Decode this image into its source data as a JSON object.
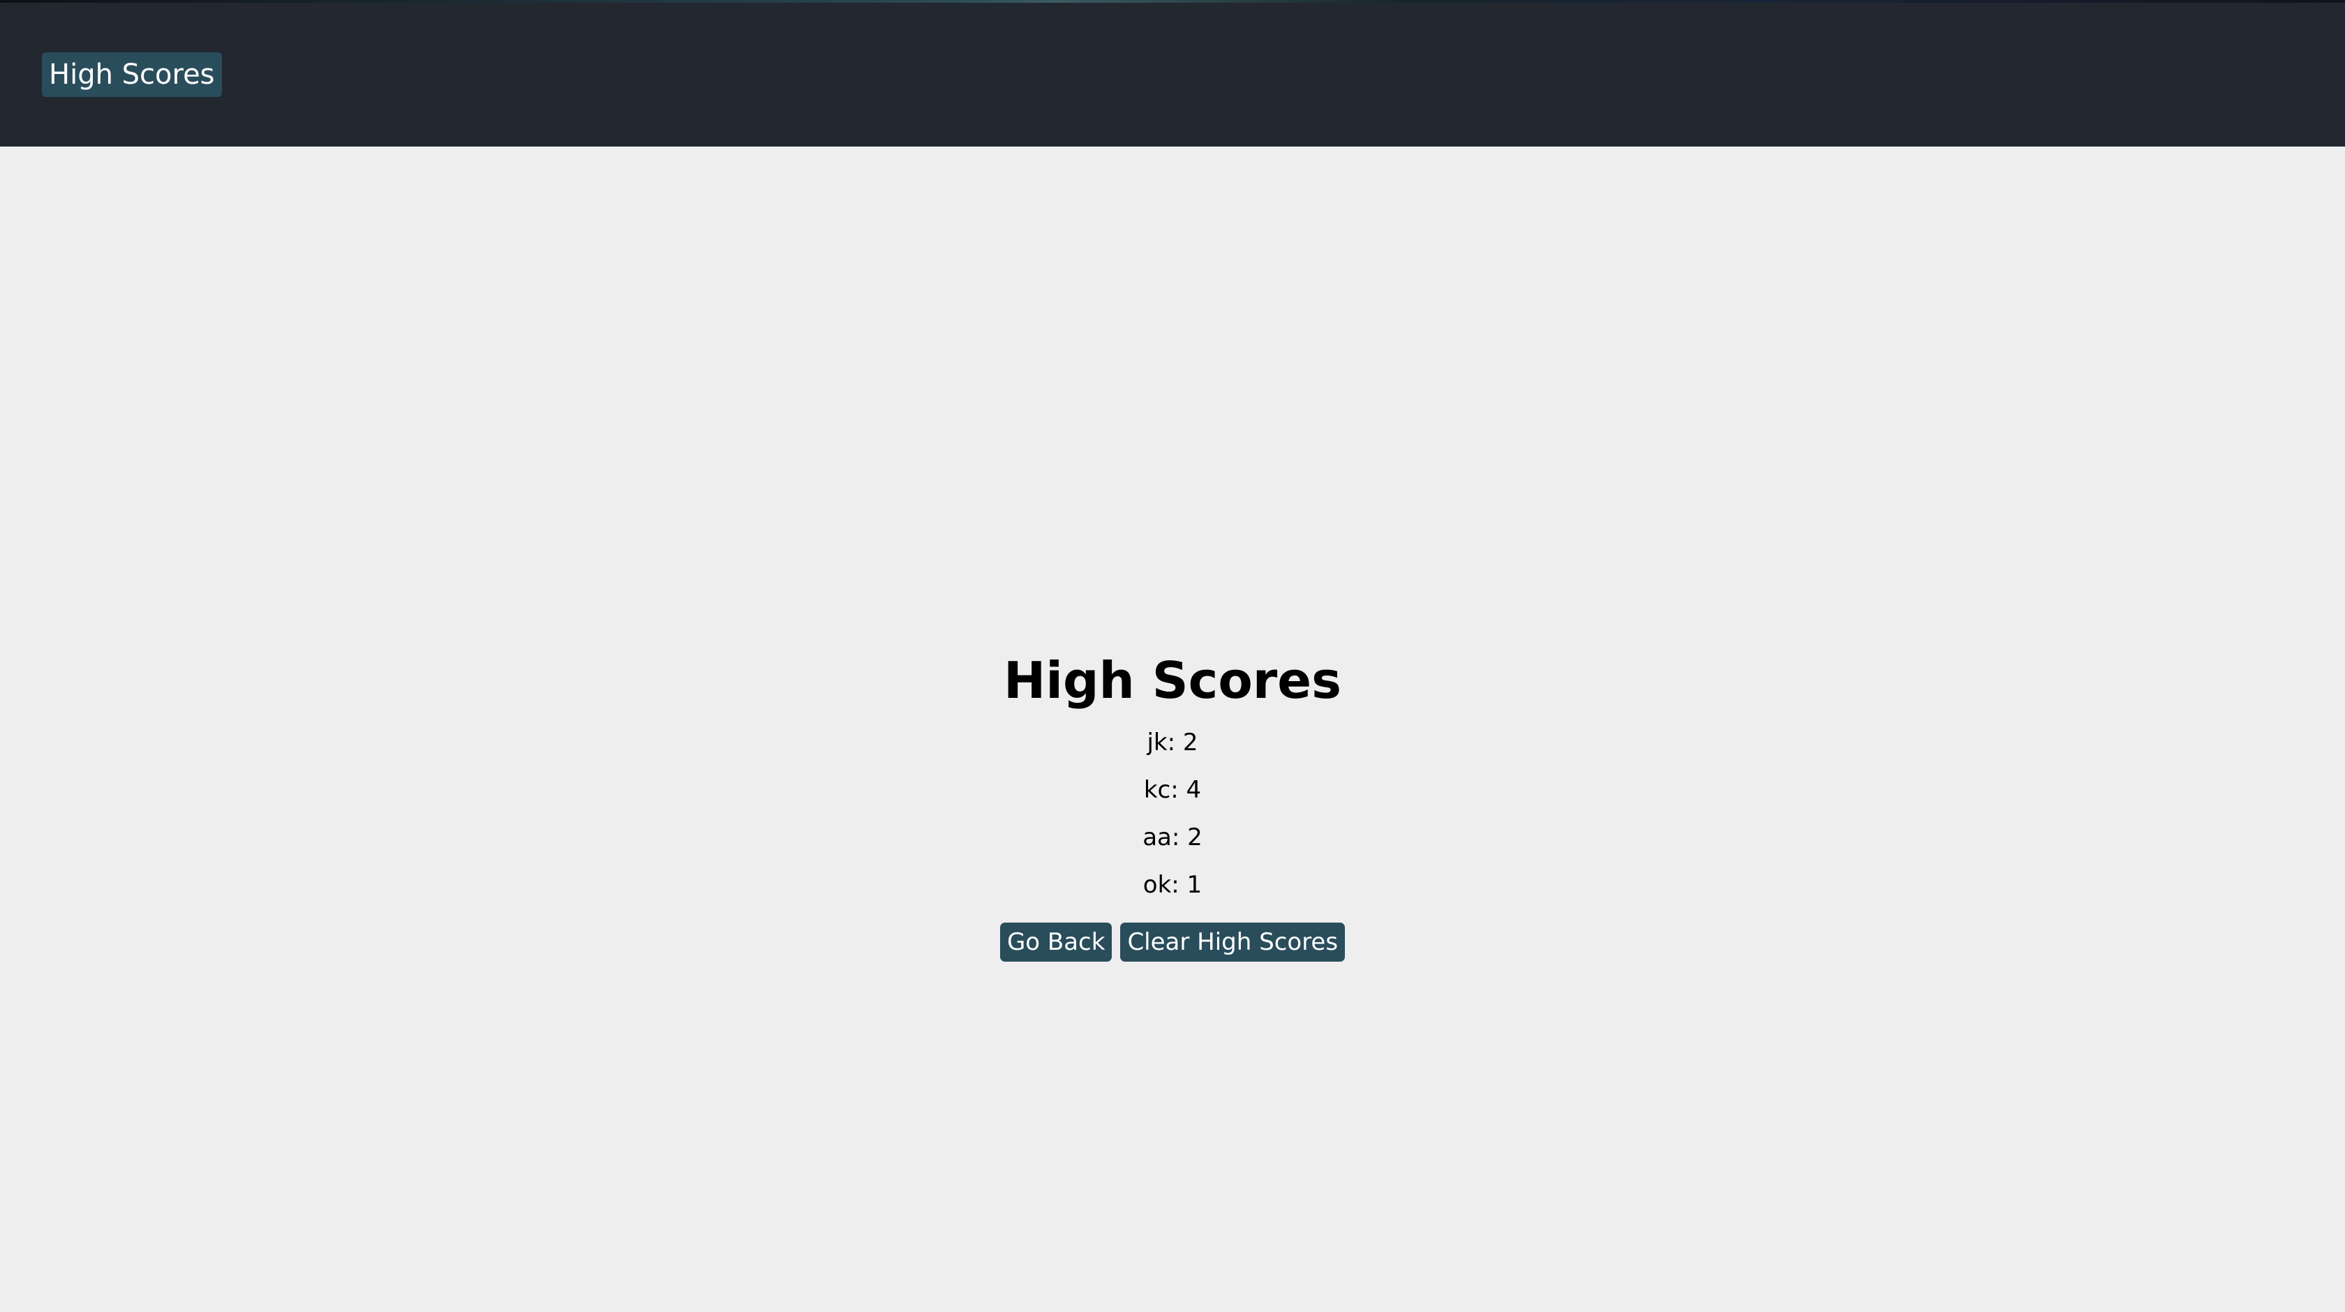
{
  "header": {
    "button_label": "High Scores"
  },
  "main": {
    "title": "High Scores",
    "scores": [
      {
        "text": "jk: 2"
      },
      {
        "text": "kc: 4"
      },
      {
        "text": "aa: 2"
      },
      {
        "text": "ok: 1"
      }
    ],
    "go_back_label": "Go Back",
    "clear_label": "Clear High Scores"
  },
  "colors": {
    "header_bg": "#222730",
    "button_bg": "#2a4d5b",
    "page_bg": "#eeeeee"
  }
}
